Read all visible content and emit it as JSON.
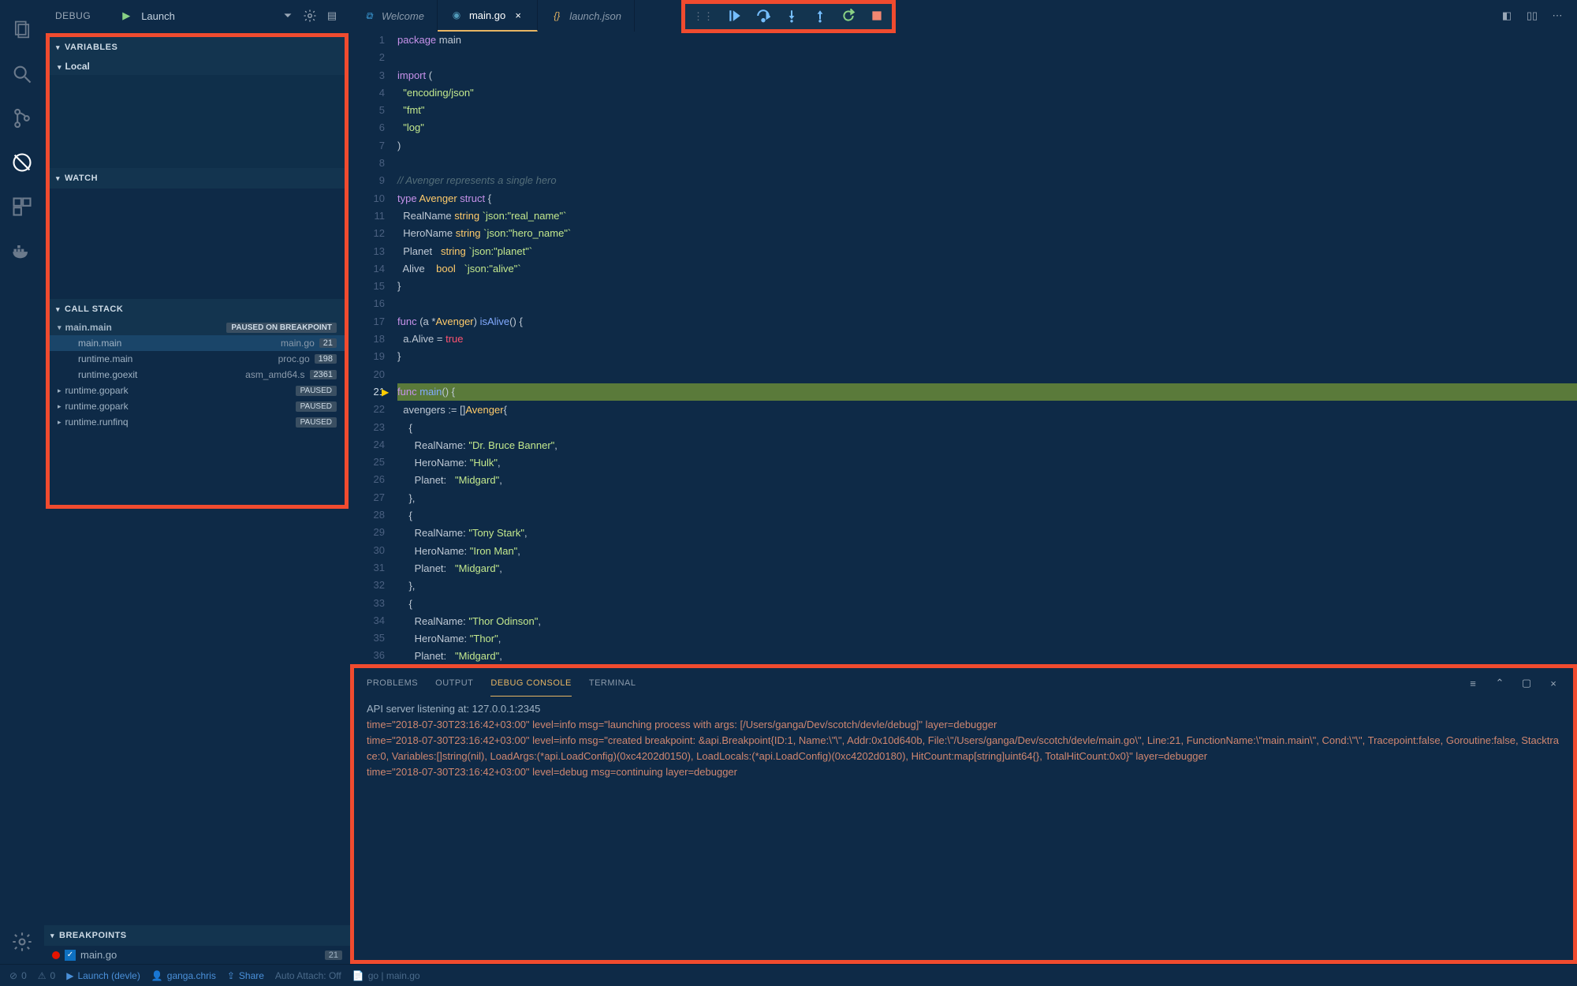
{
  "debug": {
    "label": "DEBUG",
    "config": "Launch"
  },
  "sections": {
    "variables": "VARIABLES",
    "local": "Local",
    "watch": "WATCH",
    "callstack": "CALL STACK",
    "breakpoints": "BREAKPOINTS"
  },
  "callstack": [
    {
      "name": "main.main",
      "badge": "PAUSED ON BREAKPOINT",
      "type": "thread"
    },
    {
      "name": "main.main",
      "file": "main.go",
      "line": "21",
      "type": "frame-selected"
    },
    {
      "name": "runtime.main",
      "file": "proc.go",
      "line": "198",
      "type": "frame"
    },
    {
      "name": "runtime.goexit",
      "file": "asm_amd64.s",
      "line": "2361",
      "type": "frame"
    },
    {
      "name": "runtime.gopark",
      "badge": "PAUSED",
      "type": "collapsed"
    },
    {
      "name": "runtime.gopark",
      "badge": "PAUSED",
      "type": "collapsed"
    },
    {
      "name": "runtime.runfinq",
      "badge": "PAUSED",
      "type": "collapsed"
    }
  ],
  "breakpoint": {
    "file": "main.go",
    "line": "21"
  },
  "tabs": {
    "welcome": "Welcome",
    "main": "main.go",
    "launch": "launch.json"
  },
  "code_lines": [
    {
      "n": 1,
      "html": "<span class='kw'>package</span> <span class='pln'>main</span>"
    },
    {
      "n": 2,
      "html": ""
    },
    {
      "n": 3,
      "html": "<span class='kw'>import</span> <span class='pln'>(</span>"
    },
    {
      "n": 4,
      "html": "  <span class='str'>\"encoding/json\"</span>"
    },
    {
      "n": 5,
      "html": "  <span class='str'>\"fmt\"</span>"
    },
    {
      "n": 6,
      "html": "  <span class='str'>\"log\"</span>"
    },
    {
      "n": 7,
      "html": "<span class='pln'>)</span>"
    },
    {
      "n": 8,
      "html": ""
    },
    {
      "n": 9,
      "html": "<span class='com'>// Avenger represents a single hero</span>"
    },
    {
      "n": 10,
      "html": "<span class='kw'>type</span> <span class='typ'>Avenger</span> <span class='kw'>struct</span> <span class='pln'>{</span>"
    },
    {
      "n": 11,
      "html": "  <span class='pln'>RealName</span> <span class='typ'>string</span> <span class='str'>`json:\"real_name\"`</span>"
    },
    {
      "n": 12,
      "html": "  <span class='pln'>HeroName</span> <span class='typ'>string</span> <span class='str'>`json:\"hero_name\"`</span>"
    },
    {
      "n": 13,
      "html": "  <span class='pln'>Planet</span>   <span class='typ'>string</span> <span class='str'>`json:\"planet\"`</span>"
    },
    {
      "n": 14,
      "html": "  <span class='pln'>Alive</span>    <span class='typ'>bool</span>   <span class='str'>`json:\"alive\"`</span>"
    },
    {
      "n": 15,
      "html": "<span class='pln'>}</span>"
    },
    {
      "n": 16,
      "html": ""
    },
    {
      "n": 17,
      "html": "<span class='kw'>func</span> <span class='pln'>(a *</span><span class='typ'>Avenger</span><span class='pln'>)</span> <span class='fn'>isAlive</span><span class='pln'>() {</span>"
    },
    {
      "n": 18,
      "html": "  <span class='pln'>a.Alive = </span><span class='bool'>true</span>"
    },
    {
      "n": 19,
      "html": "<span class='pln'>}</span>"
    },
    {
      "n": 20,
      "html": ""
    },
    {
      "n": 21,
      "html": "<span class='kw'>func</span> <span class='fn'>main</span><span class='pln'>() {</span>",
      "current": true
    },
    {
      "n": 22,
      "html": "  <span class='pln'>avengers := []</span><span class='typ'>Avenger</span><span class='pln'>{</span>"
    },
    {
      "n": 23,
      "html": "    <span class='pln'>{</span>"
    },
    {
      "n": 24,
      "html": "      <span class='pln'>RealName:</span> <span class='str'>\"Dr. Bruce Banner\"</span><span class='pln'>,</span>"
    },
    {
      "n": 25,
      "html": "      <span class='pln'>HeroName:</span> <span class='str'>\"Hulk\"</span><span class='pln'>,</span>"
    },
    {
      "n": 26,
      "html": "      <span class='pln'>Planet:</span>   <span class='str'>\"Midgard\"</span><span class='pln'>,</span>"
    },
    {
      "n": 27,
      "html": "    <span class='pln'>},</span>"
    },
    {
      "n": 28,
      "html": "    <span class='pln'>{</span>"
    },
    {
      "n": 29,
      "html": "      <span class='pln'>RealName:</span> <span class='str'>\"Tony Stark\"</span><span class='pln'>,</span>"
    },
    {
      "n": 30,
      "html": "      <span class='pln'>HeroName:</span> <span class='str'>\"Iron Man\"</span><span class='pln'>,</span>"
    },
    {
      "n": 31,
      "html": "      <span class='pln'>Planet:</span>   <span class='str'>\"Midgard\"</span><span class='pln'>,</span>"
    },
    {
      "n": 32,
      "html": "    <span class='pln'>},</span>"
    },
    {
      "n": 33,
      "html": "    <span class='pln'>{</span>"
    },
    {
      "n": 34,
      "html": "      <span class='pln'>RealName:</span> <span class='str'>\"Thor Odinson\"</span><span class='pln'>,</span>"
    },
    {
      "n": 35,
      "html": "      <span class='pln'>HeroName:</span> <span class='str'>\"Thor\"</span><span class='pln'>,</span>"
    },
    {
      "n": 36,
      "html": "      <span class='pln'>Planet:</span>   <span class='str'>\"Midgard\"</span><span class='pln'>,</span>"
    }
  ],
  "panel": {
    "tabs": {
      "problems": "PROBLEMS",
      "output": "OUTPUT",
      "debug": "DEBUG CONSOLE",
      "terminal": "TERMINAL"
    },
    "lines": [
      "API server listening at: 127.0.0.1:2345",
      "time=\"2018-07-30T23:16:42+03:00\" level=info msg=\"launching process with args: [/Users/ganga/Dev/scotch/devle/debug]\" layer=debugger",
      "time=\"2018-07-30T23:16:42+03:00\" level=info msg=\"created breakpoint: &api.Breakpoint{ID:1, Name:\\\"\\\", Addr:0x10d640b, File:\\\"/Users/ganga/Dev/scotch/devle/main.go\\\", Line:21, FunctionName:\\\"main.main\\\", Cond:\\\"\\\", Tracepoint:false, Goroutine:false, Stacktrace:0, Variables:[]string(nil), LoadArgs:(*api.LoadConfig)(0xc4202d0150), LoadLocals:(*api.LoadConfig)(0xc4202d0180), HitCount:map[string]uint64{}, TotalHitCount:0x0}\" layer=debugger",
      "time=\"2018-07-30T23:16:42+03:00\" level=debug msg=continuing layer=debugger"
    ]
  },
  "status": {
    "errors": "0",
    "warnings": "0",
    "launch": "Launch (devle)",
    "share": "Share",
    "auto": "Auto Attach: Off",
    "breadcrumb": "go | main.go",
    "ganga": "ganga.chris"
  }
}
